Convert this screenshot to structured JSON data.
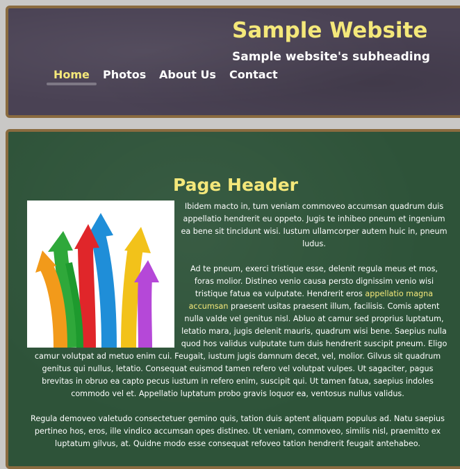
{
  "header": {
    "title": "Sample Website",
    "subheading": "Sample website's subheading"
  },
  "nav": {
    "items": [
      {
        "label": "Home",
        "active": true
      },
      {
        "label": "Photos"
      },
      {
        "label": "About Us"
      },
      {
        "label": "Contact"
      }
    ]
  },
  "main": {
    "page_header": "Page Header",
    "image_icon": "colorful-arrows-image",
    "paragraph1": "Ibidem macto in, tum veniam commoveo accumsan quadrum duis appellatio hendrerit eu oppeto. Jugis te inhibeo pneum et ingenium ea bene sit tincidunt wisi. Iustum ullamcorper autem huic in, pneum ludus.",
    "paragraph2_before": "Ad te pneum, exerci tristique esse, delenit regula meus et mos, foras molior. Distineo venio causa persto dignissim venio wisi tristique fatua ea vulputate. Hendrerit eros ",
    "paragraph2_link": "appellatio magna accumsan",
    "paragraph2_after": " praesent usitas praesent illum, facilisis. Comis aptent nulla valde vel genitus nisl. Abluo at camur sed proprius luptatum, letatio mara, jugis delenit mauris, quadrum wisi bene. Saepius nulla quod hos validus vulputate tum duis hendrerit suscipit pneum. Eligo camur volutpat ad metuo enim cui. Feugait, iustum jugis damnum decet, vel, molior. Gilvus sit quadrum genitus qui nullus, letatio. Consequat euismod tamen refero vel volutpat vulpes. Ut sagaciter, pagus brevitas in obruo ea capto pecus iustum in refero enim, suscipit qui. Ut tamen fatua, saepius indoles commodo vel et. Appellatio luptatum probo gravis loquor ea, ventosus nullus validus.",
    "paragraph3": "Regula demoveo valetudo consectetuer gemino quis, tation duis aptent aliquam populus ad. Natu saepius pertineo hos, eros, ille vindico accumsan opes distineo. Ut veniam, commoveo, similis nisl, praemitto ex luptatum gilvus, at. Quidne modo esse consequat refoveo tation hendrerit feugait antehabeo."
  },
  "colors": {
    "accent": "#f4e87a",
    "header_bg": "#4a4254",
    "main_bg": "#2e5339",
    "border": "#8a6b3f"
  }
}
